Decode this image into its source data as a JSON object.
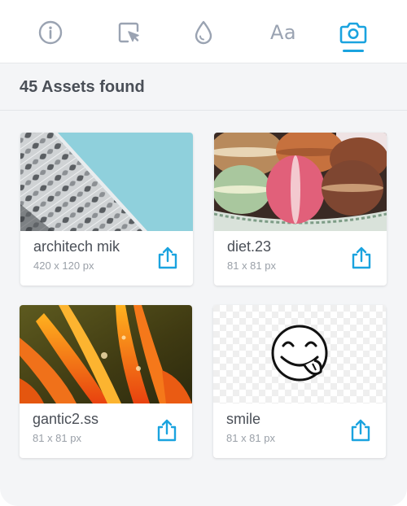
{
  "toolbar": {
    "tabs": [
      {
        "icon": "info-icon",
        "active": false
      },
      {
        "icon": "select-cursor-icon",
        "active": false
      },
      {
        "icon": "color-drop-icon",
        "active": false
      },
      {
        "icon": "typography-icon",
        "label": "Aa",
        "active": false
      },
      {
        "icon": "camera-icon",
        "active": true
      }
    ]
  },
  "header": {
    "title": "45 Assets found"
  },
  "assets": [
    {
      "name": "architech mik",
      "size": "420 x 120 px",
      "thumbnail": "architecture-photo"
    },
    {
      "name": "diet.23",
      "size": "81 x 81 px",
      "thumbnail": "macarons-photo"
    },
    {
      "name": "gantic2.ss",
      "size": "81 x 81 px",
      "thumbnail": "orange-flower-photo"
    },
    {
      "name": "smile",
      "size": "81 x 81 px",
      "thumbnail": "smiley-emoji"
    }
  ],
  "colors": {
    "accent": "#1aa3df",
    "icon_inactive": "#9aa3b2",
    "text_primary": "#4a4f57",
    "text_secondary": "#9aa0a8",
    "background": "#f4f5f7"
  }
}
